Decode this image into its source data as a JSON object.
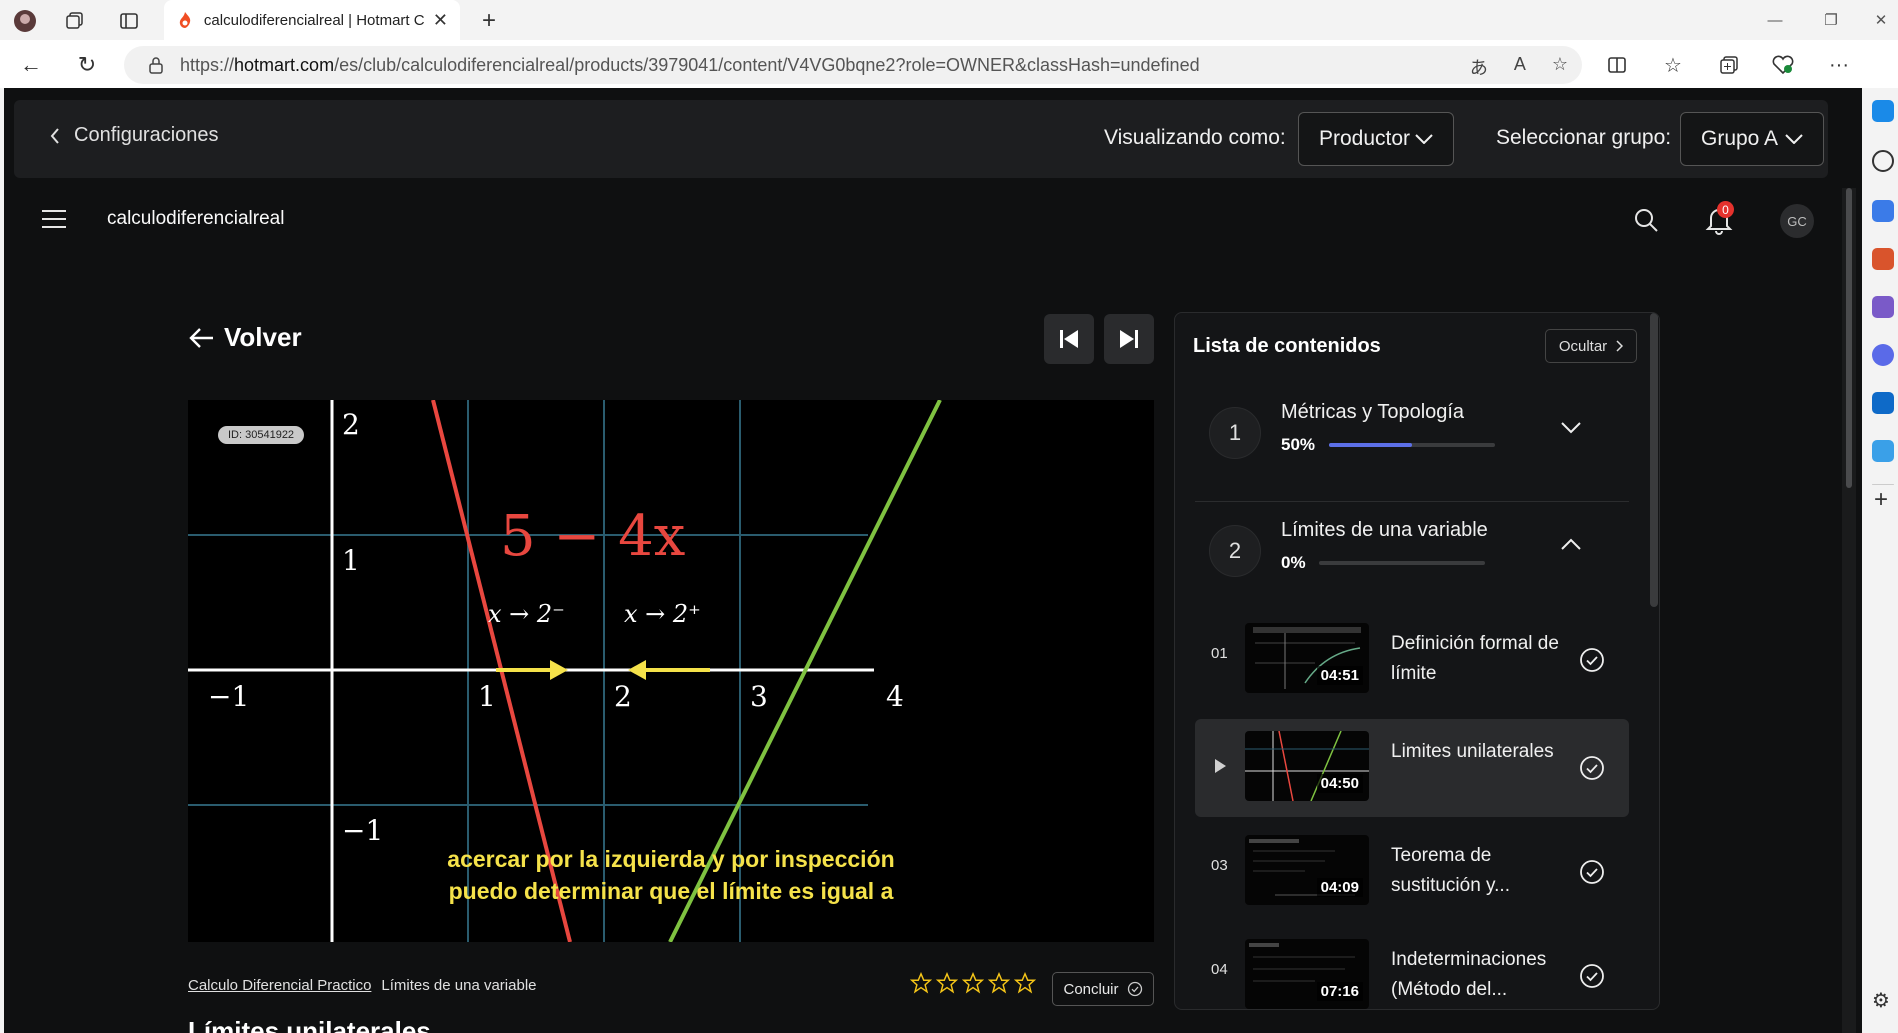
{
  "browser": {
    "tab_title": "calculodiferencialreal | Hotmart C",
    "url_prefix": "https://",
    "url_host": "hotmart.com",
    "url_path": "/es/club/calculodiferencialreal/products/3979041/content/V4VG0bqne2?role=OWNER&classHash=undefined"
  },
  "topbar": {
    "back_label": "Configuraciones",
    "viewing_as_label": "Visualizando como:",
    "viewing_as_value": "Productor",
    "group_label": "Seleccionar grupo:",
    "group_value": "Grupo A"
  },
  "header": {
    "brand": "calculodiferencialreal",
    "notification_count": "0",
    "avatar_initials": "GC"
  },
  "player": {
    "back_label": "Volver",
    "video_id": "ID: 30541922",
    "expression": "5 − 4x",
    "limit_left": "x → 2⁻",
    "limit_right": "x → 2⁺",
    "axis_ticks_x": [
      "−1",
      "1",
      "2",
      "3",
      "4"
    ],
    "axis_ticks_y": [
      "2",
      "1",
      "−1"
    ],
    "caption_line1": "acercar por la izquierda y por inspección",
    "caption_line2": "puedo determinar que el límite es igual a"
  },
  "breadcrumb": {
    "course": "Calculo Diferencial Practico",
    "module": "Límites de una variable"
  },
  "rating": {
    "stars": 5,
    "filled": 0
  },
  "complete_button": "Concluir",
  "lesson_heading_peek": "Límites unilaterales",
  "content_list": {
    "title": "Lista de contenidos",
    "hide_label": "Ocultar",
    "modules": [
      {
        "number": "1",
        "name": "Métricas y Topología",
        "progress_label": "50%",
        "progress": 0.5,
        "expanded": false
      },
      {
        "number": "2",
        "name": "Límites de una variable",
        "progress_label": "0%",
        "progress": 0,
        "expanded": true
      }
    ],
    "lessons": [
      {
        "number": "01",
        "title": "Definición formal de límite",
        "duration": "04:51",
        "active": false
      },
      {
        "number": "",
        "title": "Limites unilaterales",
        "duration": "04:50",
        "active": true
      },
      {
        "number": "03",
        "title": "Teorema de sustitución y...",
        "duration": "04:09",
        "active": false
      },
      {
        "number": "04",
        "title": "Indeterminaciones (Método del...",
        "duration": "07:16",
        "active": false
      }
    ]
  },
  "colors": {
    "accent": "#5c6fe8",
    "caption": "#f5e24a",
    "red_line": "#e8473f",
    "green_line": "#7fc241",
    "grid": "#2a5c6e"
  }
}
